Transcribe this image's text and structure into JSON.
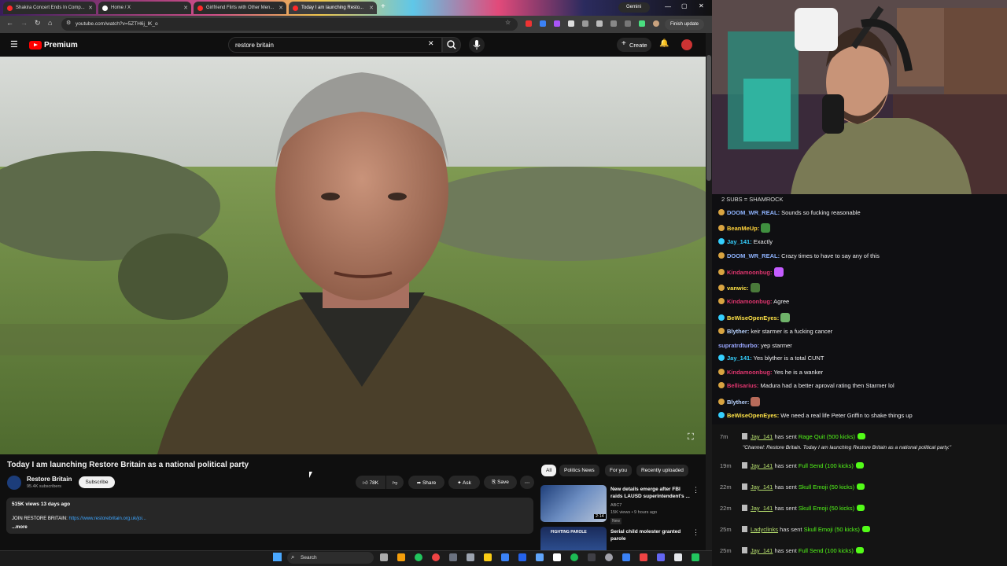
{
  "browser": {
    "tabs": [
      {
        "label": "Shakira Concert Ends In Comp..."
      },
      {
        "label": "Home / X"
      },
      {
        "label": "Girlfriend Flirts with Other Men..."
      },
      {
        "label": "Today I am launching Resto..."
      }
    ],
    "gemini_label": "Gemini",
    "url": "youtube.com/watch?v=5ZTH6j_lK_o",
    "finish_update_label": "Finish update"
  },
  "youtube": {
    "brand": "Premium",
    "search_value": "restore britain",
    "create_label": "Create",
    "video": {
      "title": "Today I am launching Restore Britain as a national political party",
      "channel_name": "Restore Britain",
      "channel_subs": "95.4K subscribers",
      "subscribe_label": "Subscribe",
      "likes": "78K",
      "share_label": "Share",
      "ask_label": "Ask",
      "save_label": "Save",
      "views_meta": "515K views  13 days ago",
      "desc_prefix": "JOIN RESTORE BRITAIN: ",
      "desc_link": "https://www.restorebritain.org.uk/joi...",
      "desc_more": "...more"
    },
    "chips": [
      {
        "label": "All"
      },
      {
        "label": "Politics News"
      },
      {
        "label": "For you"
      },
      {
        "label": "Recently uploaded"
      }
    ],
    "recommendations": [
      {
        "title": "New details emerge after FBI raids LAUSD superintendent's ...",
        "channel": "ABC7",
        "meta": "15K views • 9 hours ago",
        "badge": "New",
        "duration": "2:14"
      },
      {
        "title": "Serial child molester granted parole",
        "thumb_label": "FIGHTING PAROLE"
      }
    ]
  },
  "taskbar": {
    "search_label": "Search"
  },
  "stream": {
    "caption": "2 SUBS = SHAMROCK",
    "chat": [
      {
        "user": "DOOM_WR_REAL:",
        "text": " Sounds so fucking reasonable",
        "color": "#8fb4ff"
      },
      {
        "user": "BeanMeUp:",
        "text": "",
        "color": "#ffd23b",
        "emote": "#3f8f3f"
      },
      {
        "user": "Jay_141:",
        "text": " Exactly",
        "color": "#35d0ff"
      },
      {
        "user": "DOOM_WR_REAL:",
        "text": " Crazy times to have to say any of this",
        "color": "#8fb4ff"
      },
      {
        "user": "Kindamoonbug:",
        "text": "",
        "color": "#e0366f",
        "emote": "#c45cff"
      },
      {
        "user": "vanwic:",
        "text": "",
        "color": "#ffe347",
        "emote": "#4a7a3a"
      },
      {
        "user": "Kindamoonbug:",
        "text": " Agree",
        "color": "#e0366f"
      },
      {
        "user": "BeWiseOpenEyes:",
        "text": "",
        "color": "#ffe347",
        "emote": "#6fb36a"
      },
      {
        "user": "Blyther:",
        "text": " keir starmer is a fucking cancer",
        "color": "#b9d3ff"
      },
      {
        "user": "supratrdturbo:",
        "text": " yep starmer",
        "color": "#9aa7ff"
      },
      {
        "user": "Jay_141:",
        "text": " Yes blyther is a total CUNT",
        "color": "#35d0ff"
      },
      {
        "user": "Kindamoonbug:",
        "text": " Yes he is a wanker",
        "color": "#e0366f"
      },
      {
        "user": "Bellisarius:",
        "text": " Madura had a better aproval rating then Starmer lol",
        "color": "#e0366f"
      },
      {
        "user": "Blyther:",
        "text": "",
        "color": "#b9d3ff",
        "emote": "#b86b5a"
      },
      {
        "user": "BeWiseOpenEyes:",
        "text": " We need a real life Peter Griffin to shake things up",
        "color": "#ffe347"
      }
    ],
    "kicks": [
      {
        "time": "7m",
        "user": "Jay_141",
        "mid": " has sent ",
        "gift": "Rage Quit (500 kicks)"
      },
      {
        "time": "19m",
        "user": "Jay_141",
        "mid": " has sent ",
        "gift": "Full Send (100 kicks)"
      },
      {
        "time": "22m",
        "user": "Jay_141",
        "mid": " has sent ",
        "gift": "Skull Emoji (50 kicks)"
      },
      {
        "time": "22m",
        "user": "Jay_141",
        "mid": " has sent ",
        "gift": "Skull Emoji (50 kicks)"
      },
      {
        "time": "25m",
        "user": "Ladyclinks",
        "mid": " has sent ",
        "gift": "Skull Emoji (50 kicks)"
      },
      {
        "time": "25m",
        "user": "Jay_141",
        "mid": " has sent ",
        "gift": "Full Send (100 kicks)"
      }
    ],
    "kick_quote": "\"Channel: Restore Britain. Today I am launching Restore Britain as a national political party.\""
  }
}
